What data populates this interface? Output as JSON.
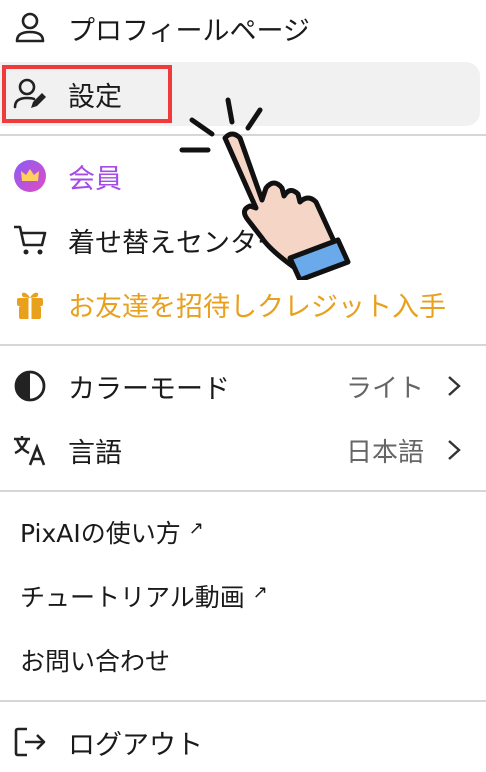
{
  "menu": {
    "profile": {
      "label": "プロフィールページ",
      "icon": "user-icon"
    },
    "settings": {
      "label": "設定",
      "icon": "user-edit-icon"
    },
    "member": {
      "label": "会員",
      "icon": "crown-icon",
      "color": "#a64ce6"
    },
    "shop": {
      "label": "着せ替えセンター",
      "icon": "cart-icon"
    },
    "invite": {
      "label": "お友達を招待しクレジット入手",
      "icon": "gift-icon",
      "color": "#e8a01d"
    },
    "color_mode": {
      "label": "カラーモード",
      "value": "ライト",
      "icon": "contrast-icon"
    },
    "language": {
      "label": "言語",
      "value": "日本語",
      "icon": "translate-icon"
    },
    "howto": {
      "label": "PixAIの使い方",
      "ext": "↗"
    },
    "tutorial": {
      "label": "チュートリアル動画",
      "ext": "↗"
    },
    "contact": {
      "label": "お問い合わせ"
    },
    "logout": {
      "label": "ログアウト",
      "icon": "logout-icon"
    }
  },
  "colors": {
    "highlight": "#ef3b3b",
    "accent_purple": "#a64ce6",
    "accent_orange": "#e8a01d"
  }
}
